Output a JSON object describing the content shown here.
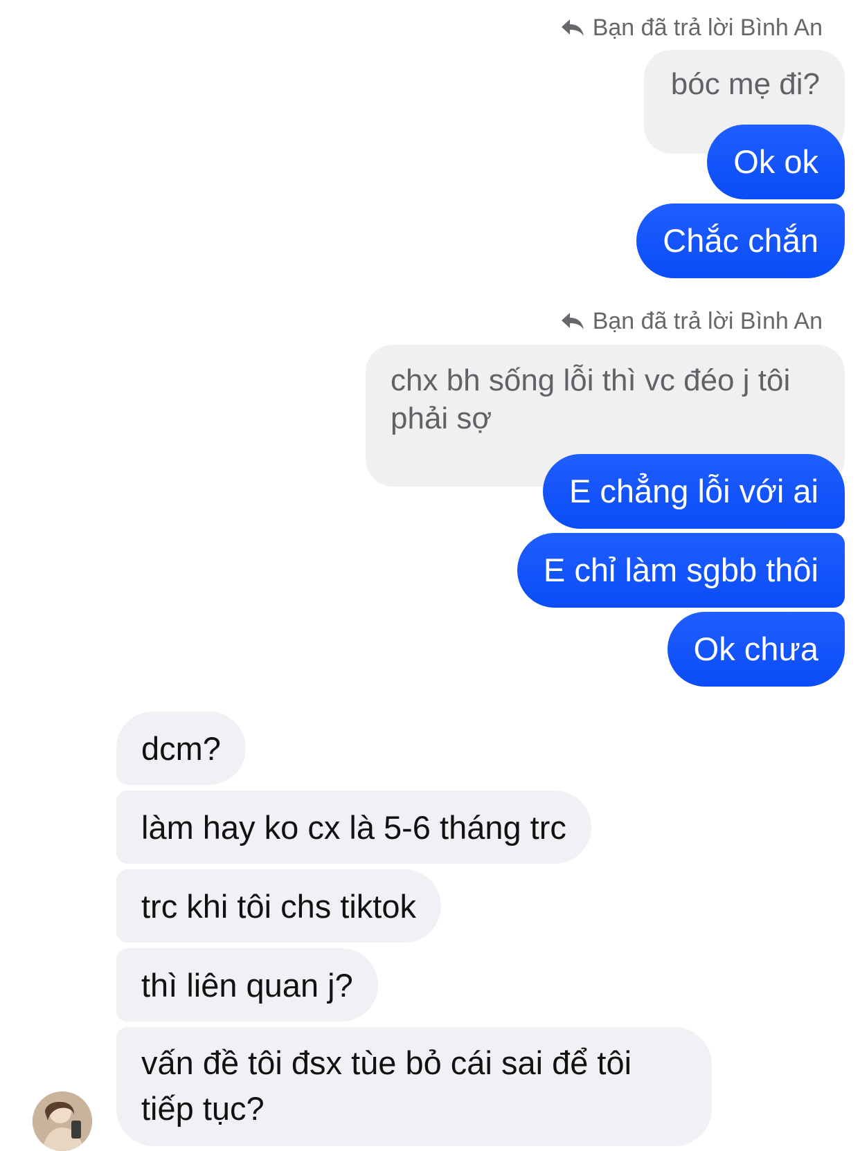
{
  "conversation": {
    "reply_label_1": "Bạn đã trả lời Bình An",
    "quoted_1": "bóc mẹ đi?",
    "reply_label_2": "Bạn đã trả lời Bình An",
    "quoted_2": "chx bh sống lỗi thì vc đéo j tôi phải sợ",
    "outgoing": [
      "Ok ok",
      "Chắc chắn",
      "E chẳng lỗi với ai",
      "E chỉ làm sgbb thôi",
      "Ok chưa"
    ],
    "incoming": [
      "dcm?",
      "làm hay ko cx là 5-6 tháng trc",
      "trc khi tôi chs tiktok",
      "thì liên quan j?",
      "vấn đề tôi đsx tùe bỏ cái sai để tôi tiếp tục?"
    ]
  },
  "icons": {
    "reply": "reply-arrow-icon",
    "avatar": "contact-avatar"
  },
  "colors": {
    "outgoing_bubble": "#0a4cf6",
    "incoming_bubble": "#f0f1f4",
    "quoted_bubble": "#f0f0f0",
    "meta_text": "#65676b"
  }
}
